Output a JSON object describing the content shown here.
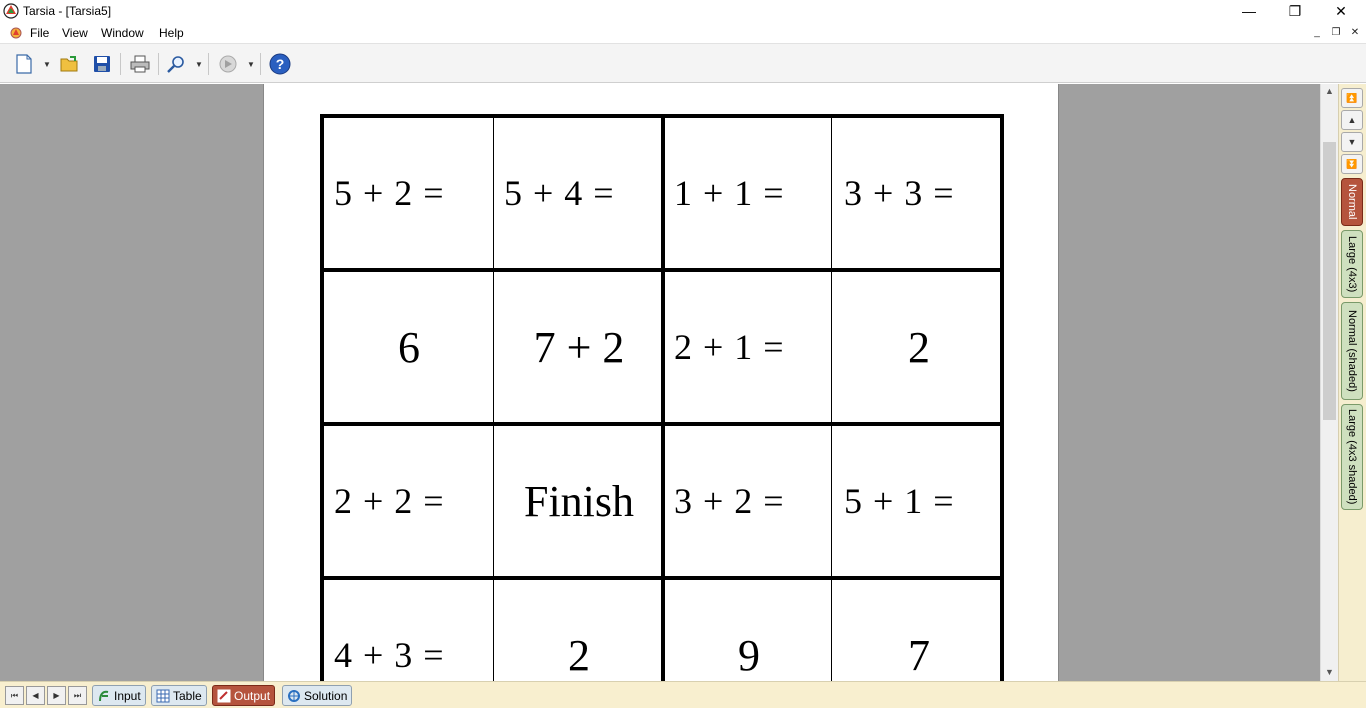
{
  "window": {
    "title": "Tarsia - [Tarsia5]",
    "controls": {
      "minimize": "—",
      "restore": "❐",
      "close": "✕"
    }
  },
  "menu": {
    "items": [
      "File",
      "View",
      "Window",
      "Help"
    ]
  },
  "toolbar": {
    "buttons": [
      "new-document",
      "open-folder",
      "save",
      "print",
      "zoom",
      "navigate",
      "help"
    ]
  },
  "grid": {
    "rows": [
      [
        {
          "text": "5 + 2 =",
          "kind": "q"
        },
        {
          "text": "5 + 4 =",
          "kind": "q"
        },
        {
          "text": "1 + 1 =",
          "kind": "q"
        },
        {
          "text": "3 + 3 =",
          "kind": "q"
        }
      ],
      [
        {
          "text": "6",
          "kind": "a"
        },
        {
          "text": "7 + 2",
          "kind": "a"
        },
        {
          "text": "2 + 1 =",
          "kind": "q"
        },
        {
          "text": "2",
          "kind": "a"
        }
      ],
      [
        {
          "text": "2 + 2 =",
          "kind": "q"
        },
        {
          "text": "Finish",
          "kind": "a"
        },
        {
          "text": "3 + 2 =",
          "kind": "q"
        },
        {
          "text": "5 + 1 =",
          "kind": "q"
        }
      ],
      [
        {
          "text": "4 + 3 =",
          "kind": "q"
        },
        {
          "text": "2",
          "kind": "a"
        },
        {
          "text": "9",
          "kind": "a"
        },
        {
          "text": "7",
          "kind": "a"
        }
      ]
    ]
  },
  "right_tabs": {
    "active": "Normal",
    "items": [
      "Normal",
      "Large (4x3)",
      "Normal (shaded)",
      "Large (4x3 shaded)"
    ]
  },
  "bottom_tabs": {
    "active": "Output",
    "items": [
      "Input",
      "Table",
      "Output",
      "Solution"
    ]
  },
  "colors": {
    "active_tab": "#b5543d",
    "workspace": "#a0a0a0",
    "tab_strip": "#f6eecf"
  }
}
